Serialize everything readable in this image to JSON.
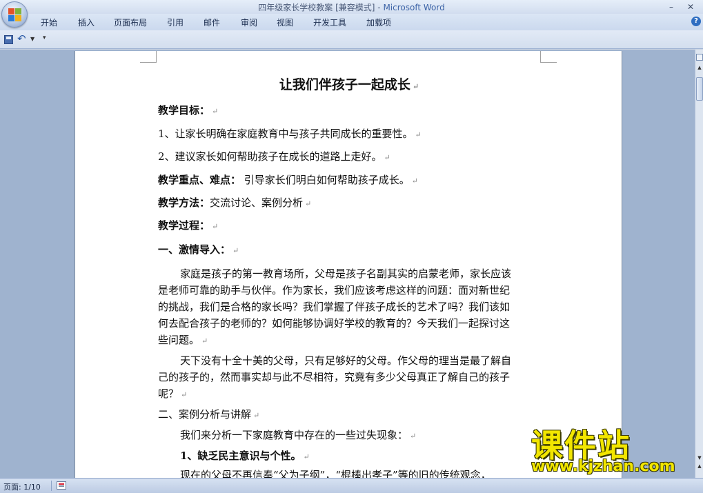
{
  "window": {
    "doc_name": "四年级家长学校教案 [兼容模式]",
    "separator": " - ",
    "app_name": "Microsoft Word",
    "minimize": "–",
    "close": "✕"
  },
  "ribbon": {
    "tabs": [
      "开始",
      "插入",
      "页面布局",
      "引用",
      "邮件",
      "审阅",
      "视图",
      "开发工具",
      "加载项"
    ],
    "help": "?"
  },
  "qat": {
    "icons": [
      "save-icon",
      "undo-icon",
      "customize-icon"
    ],
    "undo_glyph": "↶",
    "dropdown_glyph": "▼",
    "customize_glyph": "▾"
  },
  "document": {
    "title": "让我们伴孩子一起成长",
    "para_mark": "↵",
    "lines": [
      {
        "bold": "教学目标：",
        "text": ""
      },
      {
        "bold": "",
        "text": "1、让家长明确在家庭教育中与孩子共同成长的重要性。"
      },
      {
        "bold": "",
        "text": "2、建议家长如何帮助孩子在成长的道路上走好。"
      },
      {
        "bold": "教学重点、难点：",
        "text": " 引导家长们明白如何帮助孩子成长。"
      },
      {
        "bold": "教学方法：",
        "text": "交流讨论、案例分析"
      },
      {
        "bold": "教学过程：",
        "text": ""
      },
      {
        "bold": "一、激情导入：",
        "text": ""
      },
      {
        "bold": "",
        "text": "家庭是孩子的第一教育场所，父母是孩子名副其实的启蒙老师，家长应该"
      },
      {
        "bold": "",
        "text": "是老师可靠的助手与伙伴。作为家长，我们应该考虑这样的问题：面对新世纪"
      },
      {
        "bold": "",
        "text": "的挑战，我们是合格的家长吗？我们掌握了伴孩子成长的艺术了吗？我们该如"
      },
      {
        "bold": "",
        "text": "何去配合孩子的老师的？如何能够协调好学校的教育的？今天我们一起探讨这"
      },
      {
        "bold": "",
        "text": "些问题。"
      },
      {
        "bold": "",
        "text": "天下没有十全十美的父母，只有足够好的父母。作父母的理当是最了解自"
      },
      {
        "bold": "",
        "text": "己的孩子的，然而事实却与此不尽相符，究竟有多少父母真正了解自己的孩子"
      },
      {
        "bold": "",
        "text": "呢？"
      },
      {
        "bold": "",
        "text": "二、案例分析与讲解"
      },
      {
        "bold": "",
        "text": "我们来分析一下家庭教育中存在的一些过失现象："
      },
      {
        "bold": "1、缺乏民主意识与个性。",
        "text": ""
      },
      {
        "bold": "",
        "text": "现在的父母不再信奉“父为子纲”，“棍棒出孝子”等的旧的传统观念，"
      }
    ]
  },
  "status": {
    "page": "页面: 1/10"
  },
  "watermark": {
    "logo": "课件站",
    "url": "www.kjzhan.com"
  }
}
